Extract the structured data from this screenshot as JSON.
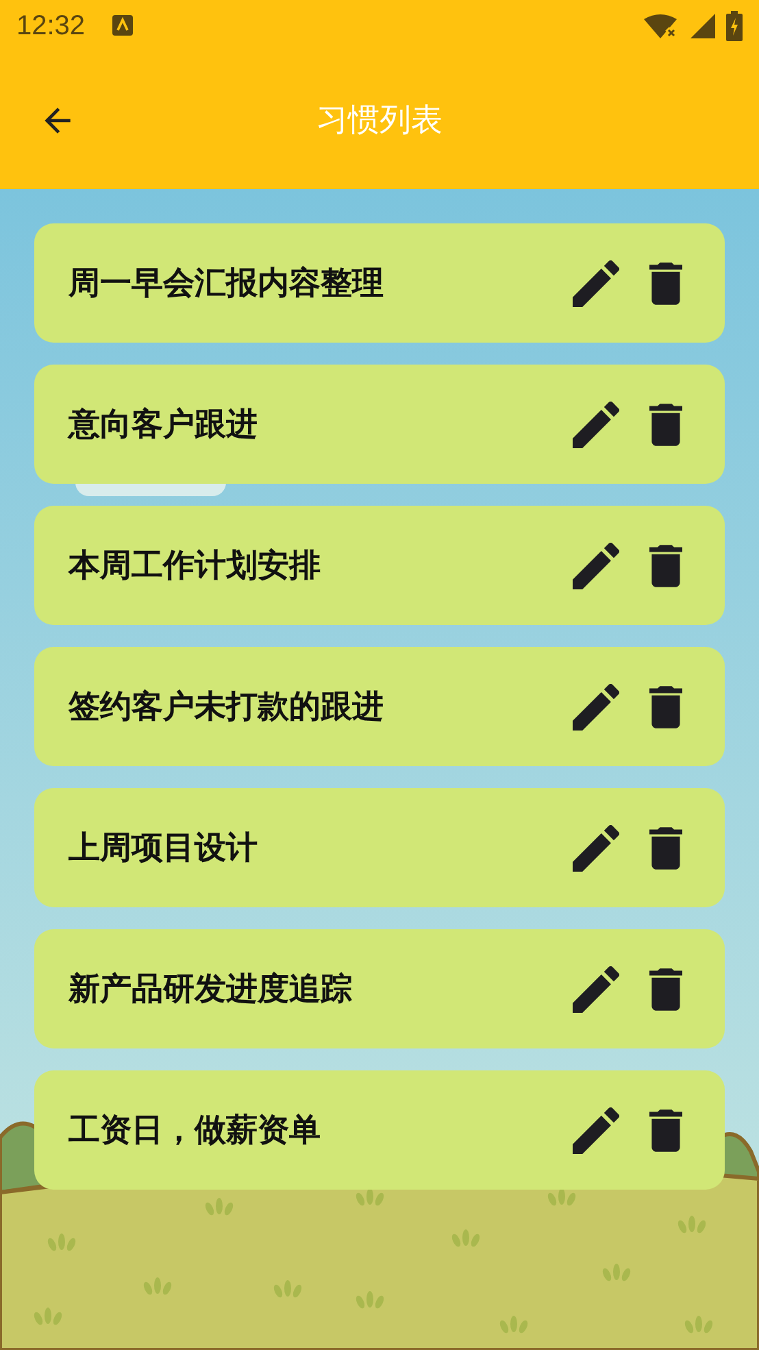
{
  "status_bar": {
    "time": "12:32"
  },
  "app_bar": {
    "title": "习惯列表"
  },
  "habits": [
    {
      "title": "周一早会汇报内容整理"
    },
    {
      "title": "意向客户跟进"
    },
    {
      "title": "本周工作计划安排"
    },
    {
      "title": "签约客户未打款的跟进"
    },
    {
      "title": "上周项目设计"
    },
    {
      "title": "新产品研发进度追踪"
    },
    {
      "title": "工资日，做薪资单"
    }
  ]
}
